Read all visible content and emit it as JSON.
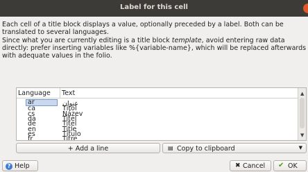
{
  "window": {
    "title": "Label for this cell"
  },
  "description": {
    "p1": "Each cell of a title block displays a value, optionally preceded by a label. Both can be translated to several languages.",
    "p2_before": "Since what you are currently editing is a title block ",
    "p2_em": "template",
    "p2_after": ", avoid entering raw data directly: prefer inserting variables like %{variable-name}, which will be replaced afterwards with adequate values in the folio."
  },
  "table": {
    "headers": {
      "language": "Language",
      "text": "Text"
    },
    "rows": [
      {
        "language": "ar",
        "text": "عنوان"
      },
      {
        "language": "ca",
        "text": "Títol"
      },
      {
        "language": "cs",
        "text": "Název"
      },
      {
        "language": "da",
        "text": "Titel"
      },
      {
        "language": "de",
        "text": "Titel"
      },
      {
        "language": "en",
        "text": "Title"
      },
      {
        "language": "es",
        "text": "Título"
      },
      {
        "language": "fr",
        "text": "Titre"
      }
    ],
    "selected_row": 0
  },
  "buttons": {
    "add_line": "+ Add a line",
    "copy": "Copy to clipboard",
    "help": "Help",
    "cancel": "Cancel",
    "ok": "OK"
  },
  "icons": {
    "close": "close-icon",
    "help": "help-icon",
    "copy": "clipboard-icon",
    "cancel": "cancel-icon",
    "ok": "checkmark-icon",
    "dropdown": "chevron-down-icon"
  },
  "colors": {
    "accent": "#3d7bd8",
    "close": "#e0572a",
    "ok_check": "#4c9a1e",
    "selection": "#c9d8ee"
  }
}
